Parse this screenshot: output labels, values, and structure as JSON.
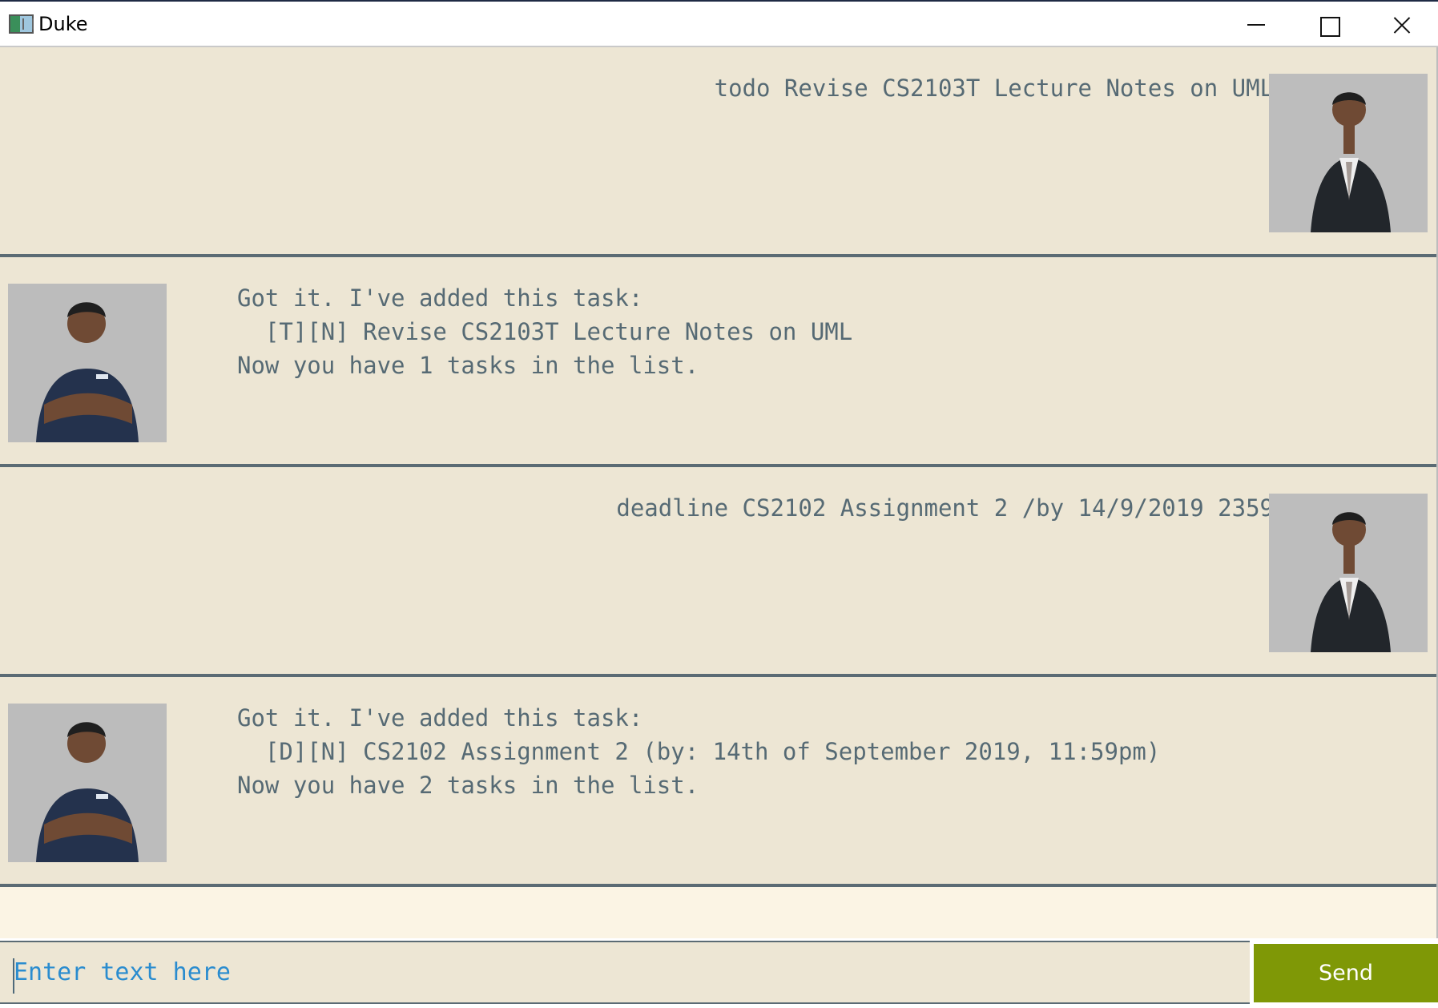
{
  "window": {
    "title": "Duke",
    "controls": [
      "minimize-icon",
      "maximize-icon",
      "close-icon"
    ]
  },
  "dialog": [
    {
      "sender": "user",
      "text": "todo Revise CS2103T Lecture Notes on UML"
    },
    {
      "sender": "bot",
      "lines": [
        "Got it. I've added this task:",
        "  [T][N] Revise CS2103T Lecture Notes on UML",
        "Now you have 1 tasks in the list."
      ]
    },
    {
      "sender": "user",
      "text": "deadline CS2102 Assignment 2 /by 14/9/2019 2359"
    },
    {
      "sender": "bot",
      "lines": [
        "Got it. I've added this task:",
        "  [D][N] CS2102 Assignment 2 (by: 14th of September 2019, 11:59pm)",
        "Now you have 2 tasks in the list."
      ]
    }
  ],
  "input": {
    "value": "",
    "placeholder": "Enter text here"
  },
  "send_button": {
    "label": "Send"
  },
  "colors": {
    "message_background": "#ede6d4",
    "chat_background": "#fbf4e4",
    "text": "#566a74",
    "placeholder": "#2a8ccf",
    "send_button": "#7f9806"
  }
}
